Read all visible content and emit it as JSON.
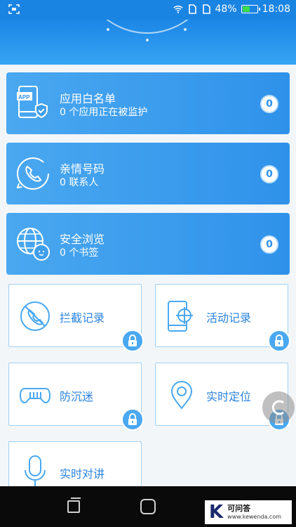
{
  "status_bar": {
    "battery_percent": "48%",
    "time": "18:08",
    "icons": [
      "scan-icon",
      "wifi-icon",
      "sim-1-icon",
      "sim-2-icon",
      "battery-icon"
    ],
    "battery_level": 0.48
  },
  "cards": [
    {
      "title": "应用白名单",
      "count": "0",
      "subtitle": "个应用正在被监护",
      "icon": "app-shield-icon",
      "badge": "0"
    },
    {
      "title": "亲情号码",
      "count": "0",
      "subtitle": "联系人",
      "icon": "phone-contact-icon",
      "badge": "0"
    },
    {
      "title": "安全浏览",
      "count": "0",
      "subtitle": "个书签",
      "icon": "safe-browse-icon",
      "badge": "0"
    }
  ],
  "tiles": [
    {
      "label": "拦截记录",
      "icon": "block-call-icon",
      "locked": true
    },
    {
      "label": "活动记录",
      "icon": "phone-target-icon",
      "locked": true
    },
    {
      "label": "防沉迷",
      "icon": "gamepad-icon",
      "locked": true
    },
    {
      "label": "实时定位",
      "icon": "location-pin-icon",
      "locked": true
    },
    {
      "label": "实时对讲",
      "icon": "microphone-icon",
      "locked": false
    }
  ],
  "watermark": {
    "logo": "K",
    "title": "可问答",
    "url": "www.kewenda.com"
  },
  "colors": {
    "accent": "#2f92ea",
    "tile_border": "#9fd1f5",
    "tile_text": "#2c84de"
  }
}
